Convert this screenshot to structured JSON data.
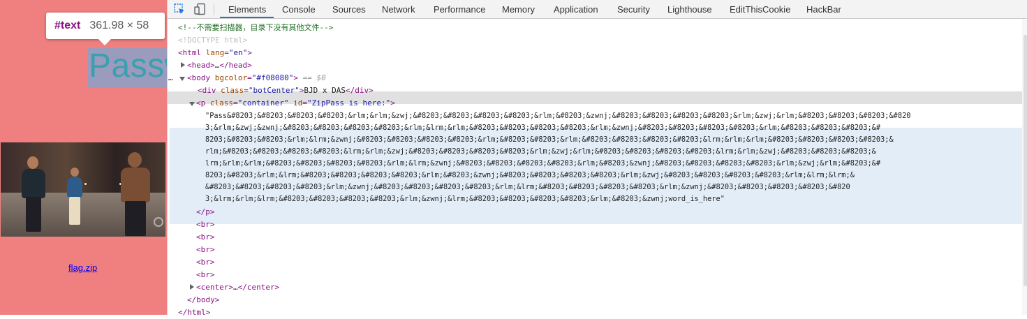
{
  "page": {
    "tooltip": {
      "tag": "#text",
      "dims": "361.98 × 58"
    },
    "pass_text": "Passw",
    "video": {
      "description_icon": "video-play-icon"
    },
    "flag_link": "flag.zip",
    "background_color": "#f08080"
  },
  "devtools": {
    "icons": [
      "inspect-element-icon",
      "device-toolbar-icon"
    ],
    "tabs": [
      {
        "label": "Elements",
        "active": true
      },
      {
        "label": "Console"
      },
      {
        "label": "Sources"
      },
      {
        "label": "Network"
      },
      {
        "label": "Performance"
      },
      {
        "label": "Memory"
      },
      {
        "label": "Application"
      },
      {
        "label": "Security"
      },
      {
        "label": "Lighthouse"
      },
      {
        "label": "EditThisCookie"
      },
      {
        "label": "HackBar"
      }
    ],
    "accent": "#1a73e8",
    "tree": {
      "comment": "<!--不需要扫描器，目录下没有其他文件-->",
      "doctype": "<!DOCTYPE html>",
      "html_open": {
        "tag": "html",
        "attr": "lang",
        "val": "\"en\""
      },
      "head": {
        "tag": "head",
        "ellipsis": "…",
        "close": "</head>"
      },
      "body_open": {
        "tag": "body",
        "attr": "bgcolor",
        "val": "\"#f08080\"",
        "eq": "== $0",
        "dots": "…"
      },
      "div": {
        "tag": "div",
        "attr": "class",
        "val": "\"botCenter\"",
        "text": "BJD x DAS",
        "close": "</div>"
      },
      "p_open": {
        "tag": "p",
        "attr1": "class",
        "val1": "\"container\"",
        "attr2": "id",
        "val2": "\"ZipPass is here:\""
      },
      "text_lines": [
        "\"Pass&#8203;&#8203;&#8203;&#8203;&rlm;&rlm;&zwj;&#8203;&#8203;&#8203;&#8203;&rlm;&#8203;&zwnj;&#8203;&#8203;&#8203;&#8203;&rlm;&zwj;&rlm;&#8203;&#8203;&#8203;&#820",
        "3;&rlm;&zwj;&zwnj;&#8203;&#8203;&#8203;&#8203;&rlm;&lrm;&rlm;&#8203;&#8203;&#8203;&#8203;&rlm;&zwnj;&#8203;&#8203;&#8203;&#8203;&rlm;&#8203;&#8203;&#8203;&#",
        "8203;&#8203;&#8203;&rlm;&lrm;&zwnj;&#8203;&#8203;&#8203;&#8203;&rlm;&#8203;&#8203;&rlm;&#8203;&#8203;&#8203;&#8203;&lrm;&rlm;&rlm;&#8203;&#8203;&#8203;&#8203;&",
        "rlm;&#8203;&#8203;&#8203;&#8203;&lrm;&rlm;&zwj;&#8203;&#8203;&#8203;&#8203;&rlm;&zwj;&rlm;&#8203;&#8203;&#8203;&#8203;&lrm;&rlm;&zwj;&#8203;&#8203;&#8203;&",
        "lrm;&rlm;&rlm;&#8203;&#8203;&#8203;&#8203;&rlm;&lrm;&zwnj;&#8203;&#8203;&#8203;&#8203;&rlm;&#8203;&zwnj;&#8203;&#8203;&#8203;&#8203;&rlm;&zwj;&rlm;&#8203;&#",
        "8203;&#8203;&rlm;&lrm;&#8203;&#8203;&#8203;&#8203;&rlm;&#8203;&zwnj;&#8203;&#8203;&#8203;&#8203;&rlm;&zwj;&#8203;&#8203;&#8203;&#8203;&rlm;&lrm;&lrm;&",
        "&#8203;&#8203;&#8203;&#8203;&rlm;&zwnj;&#8203;&#8203;&#8203;&#8203;&rlm;&lrm;&#8203;&#8203;&#8203;&#8203;&rlm;&zwnj;&#8203;&#8203;&#8203;&#8203;&#820",
        "3;&lrm;&rlm;&lrm;&#8203;&#8203;&#8203;&#8203;&rlm;&zwnj;&lrm;&#8203;&#8203;&#8203;&#8203;&rlm;&#8203;&zwnj;word_is_here\""
      ],
      "p_close": "</p>",
      "br": "<br>",
      "center": {
        "tag": "center",
        "ellipsis": "…",
        "close": "</center>"
      },
      "body_close": "</body>",
      "html_close": "</html>"
    }
  }
}
